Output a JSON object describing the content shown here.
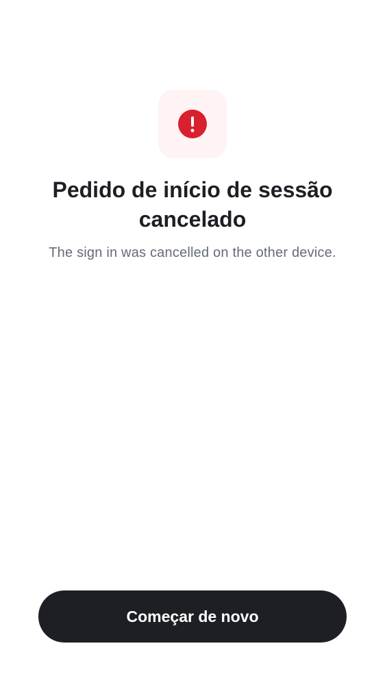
{
  "status": {
    "icon": "alert-circle-icon",
    "icon_color": "#d9202f",
    "tile_color": "#fff4f3"
  },
  "title": "Pedido de início de sessão cancelado",
  "subtitle": "The sign in was cancelled on the other device.",
  "actions": {
    "restart_label": "Começar de novo",
    "button_color": "#1e1f24"
  }
}
